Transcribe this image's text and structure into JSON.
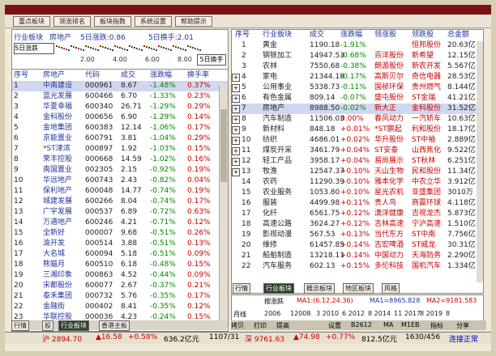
{
  "toolbar": {
    "buttons": [
      "重点板块",
      "领涨排名",
      "板块指数",
      "系统设置",
      "帮助提示"
    ]
  },
  "left_panel": {
    "header": {
      "category": "行业板块",
      "sector": "房地产",
      "limit_up": "5日涨跌:0.86",
      "turnover": "5日换手:2.01"
    },
    "mini_chart": {
      "label": "5日涨跌",
      "scale": [
        "2.00",
        "4.00",
        "6.00",
        "8.00"
      ],
      "button": "5日换手"
    },
    "columns": [
      "序号",
      "房地产",
      "代码",
      "成交",
      "涨跌幅",
      "换手率"
    ],
    "rows": [
      [
        "1",
        "中南建设",
        "000961",
        "8.67",
        "-1.48%",
        "0.37%"
      ],
      [
        "2",
        "蓝光发展",
        "600466",
        "6.70",
        "-1.33%",
        "0.23%"
      ],
      [
        "3",
        "华夏幸福",
        "600340",
        "26.71",
        "-1.29%",
        "0.29%"
      ],
      [
        "4",
        "金科股份",
        "000656",
        "6.90",
        "-1.29%",
        "0.14%"
      ],
      [
        "5",
        "金地集团",
        "600383",
        "12.14",
        "-1.06%",
        "0.17%"
      ],
      [
        "6",
        "京能置业",
        "600791",
        "3.81",
        "-1.04%",
        "0.29%"
      ],
      [
        "7",
        "*ST津滨",
        "000897",
        "1.92",
        "-1.03%",
        "0.15%"
      ],
      [
        "8",
        "荣丰控股",
        "000668",
        "14.59",
        "-1.02%",
        "0.16%"
      ],
      [
        "9",
        "南国置业",
        "002305",
        "2.15",
        "-0.92%",
        "0.19%"
      ],
      [
        "10",
        "华远地产",
        "600743",
        "2.43",
        "-0.82%",
        "0.04%"
      ],
      [
        "11",
        "保利地产",
        "600048",
        "14.77",
        "-0.74%",
        "0.19%"
      ],
      [
        "12",
        "城建发展",
        "600266",
        "8.04",
        "-0.74%",
        "0.17%"
      ],
      [
        "13",
        "广宇发展",
        "000537",
        "6.89",
        "-0.72%",
        "0.63%"
      ],
      [
        "14",
        "万通地产",
        "600246",
        "4.21",
        "-0.71%",
        "0.12%"
      ],
      [
        "15",
        "全新好",
        "000007",
        "9.68",
        "-0.51%",
        "0.26%"
      ],
      [
        "16",
        "渝开发",
        "000514",
        "3.88",
        "-0.51%",
        "0.13%"
      ],
      [
        "17",
        "大名城",
        "600094",
        "5.18",
        "-0.51%",
        "0.09%"
      ],
      [
        "18",
        "熊猫月",
        "600510",
        "6.18",
        "-0.48%",
        "0.15%"
      ],
      [
        "19",
        "三湘印象",
        "000863",
        "4.52",
        "-0.44%",
        "0.09%"
      ],
      [
        "20",
        "宋都股份",
        "600077",
        "2.67",
        "-0.37%",
        "0.21%"
      ],
      [
        "21",
        "泰禾集团",
        "000732",
        "5.76",
        "-0.35%",
        "0.17%"
      ],
      [
        "22",
        "金融街",
        "000402",
        "8.41",
        "-0.35%",
        "0.12%"
      ],
      [
        "23",
        "华联控股",
        "000036",
        "4.23",
        "-0.24%",
        "0.15%"
      ],
      [
        "24",
        "世荣兆业",
        "002016",
        "8.10",
        "-0.25%",
        "0.05%"
      ],
      [
        "25",
        "中华企业",
        "600675",
        "5.28",
        "-0.22%",
        "0.12%"
      ],
      [
        "26",
        "世联股份",
        "600823",
        "3.95",
        "-0.25%",
        "0.05%"
      ]
    ],
    "tabs": [
      "行情",
      "股",
      "行业板块",
      "香港主板"
    ]
  },
  "right_panel": {
    "columns": [
      "序号",
      "行业板块",
      "成交",
      "涨跌幅",
      "领涨股",
      "领跌股",
      "总金额"
    ],
    "rows": [
      [
        "1",
        "黄金",
        "1190.18",
        "-1.91%",
        "",
        "恒邦股份",
        "20.63亿"
      ],
      [
        "2",
        "钢铁加工",
        "14947.53",
        "-0.68%",
        "百洋股份",
        "新希望",
        "12.15亿"
      ],
      [
        "3",
        "农林",
        "7550.68",
        "-0.38%",
        "朗源股份",
        "新农开发",
        "5.567亿"
      ],
      [
        "4",
        "家电",
        "21344.18",
        "-0.17%",
        "高斯贝尔",
        "奇信电器",
        "28.53亿"
      ],
      [
        "5",
        "公用事业",
        "5338.73",
        "-0.11%",
        "国祯环保",
        "贵州燃气",
        "8.144亿"
      ],
      [
        "6",
        "有色金属",
        "809.14",
        "-0.07%",
        "盛屯股份",
        "ST金瑞",
        "41.21亿"
      ],
      [
        "7",
        "房地产",
        "8988.50",
        "-0.02%",
        "新大正",
        "金科股份",
        "31.52亿"
      ],
      [
        "8",
        "汽车制造",
        "11506.03",
        "0.00%",
        "春风动力",
        "一汽轿车",
        "10.63亿"
      ],
      [
        "9",
        "新材料",
        "848.18",
        "+0.01%",
        "*ST鹏起",
        "利和股份",
        "18.17亿"
      ],
      [
        "10",
        "纺织",
        "4686.01",
        "+0.02%",
        "华升股份",
        "ST中袖",
        "2.889亿"
      ],
      [
        "11",
        "煤炭开采",
        "3461.79",
        "+0.04%",
        "ST安泰",
        "山西焦化",
        "9.522亿"
      ],
      [
        "12",
        "轻工产品",
        "3958.17",
        "+0.04%",
        "易尚展示",
        "ST秋林",
        "6.251亿"
      ],
      [
        "13",
        "牧渔",
        "12547.37",
        "+0.10%",
        "天山生物",
        "民和股份",
        "11.34亿"
      ],
      [
        "14",
        "农药",
        "11290.39",
        "+0.10%",
        "雅本化学",
        "中农立华",
        "3.912亿"
      ],
      [
        "15",
        "农业服务",
        "1053.80",
        "+0.10%",
        "星光农机",
        "亚盛集团",
        "3010万"
      ],
      [
        "16",
        "服装",
        "4499.98",
        "+0.11%",
        "贵人鸟",
        "商赢环球",
        "4.118亿"
      ],
      [
        "17",
        "化纤",
        "6561.75",
        "+0.12%",
        "澳洋健康",
        "吉视龙杰",
        "5.873亿"
      ],
      [
        "18",
        "高速公路",
        "3624.27",
        "+0.12%",
        "吉林高速",
        "宁沪高速",
        "1.510亿"
      ],
      [
        "19",
        "影视动漫",
        "567.53",
        "+0.13%",
        "当代东方",
        "ST中南",
        "7.756亿"
      ],
      [
        "20",
        "维修",
        "61457.85",
        "+0.14%",
        "吉宏啤酒",
        "ST威龙",
        "30.31亿"
      ],
      [
        "21",
        "船舶制造",
        "13218.11",
        "+0.14%",
        "中国动力",
        "天海防务",
        "2.290亿"
      ],
      [
        "22",
        "汽车服务",
        "602.13",
        "+0.15%",
        "多伦科技",
        "国机汽车",
        "1.334亿"
      ]
    ],
    "tabs": [
      "行情",
      "行业板块",
      "概念板块",
      "地区板块",
      "风格"
    ]
  },
  "kline": {
    "label": "按涨跌",
    "ma": "MA1:(6.12,24.36)",
    "ma2": "MA1=8965.828",
    "ma3": "MA2=9181.583",
    "period": "月线",
    "dates": [
      "2006",
      "12008",
      "3 2010",
      "6 2012",
      "8 2014",
      "11 2017",
      "8 2019",
      "8"
    ]
  },
  "bottom_bar": {
    "items": [
      "拷贝",
      "打印",
      "提高",
      "设置",
      "B2612",
      "MA",
      "M1EB",
      "指标",
      "分享"
    ]
  },
  "status_bar": {
    "index1": "沪 2894.70",
    "change1": "▲16.58",
    "pct1": "+0.58%",
    "amount1": "636.2亿元",
    "count1": "1107/31",
    "index2": "深 9761.63",
    "change2": "▲74.98",
    "pct2": "+0.77%",
    "amount2": "812.5亿元",
    "count2": "1630/456",
    "conn": "连接正常"
  }
}
